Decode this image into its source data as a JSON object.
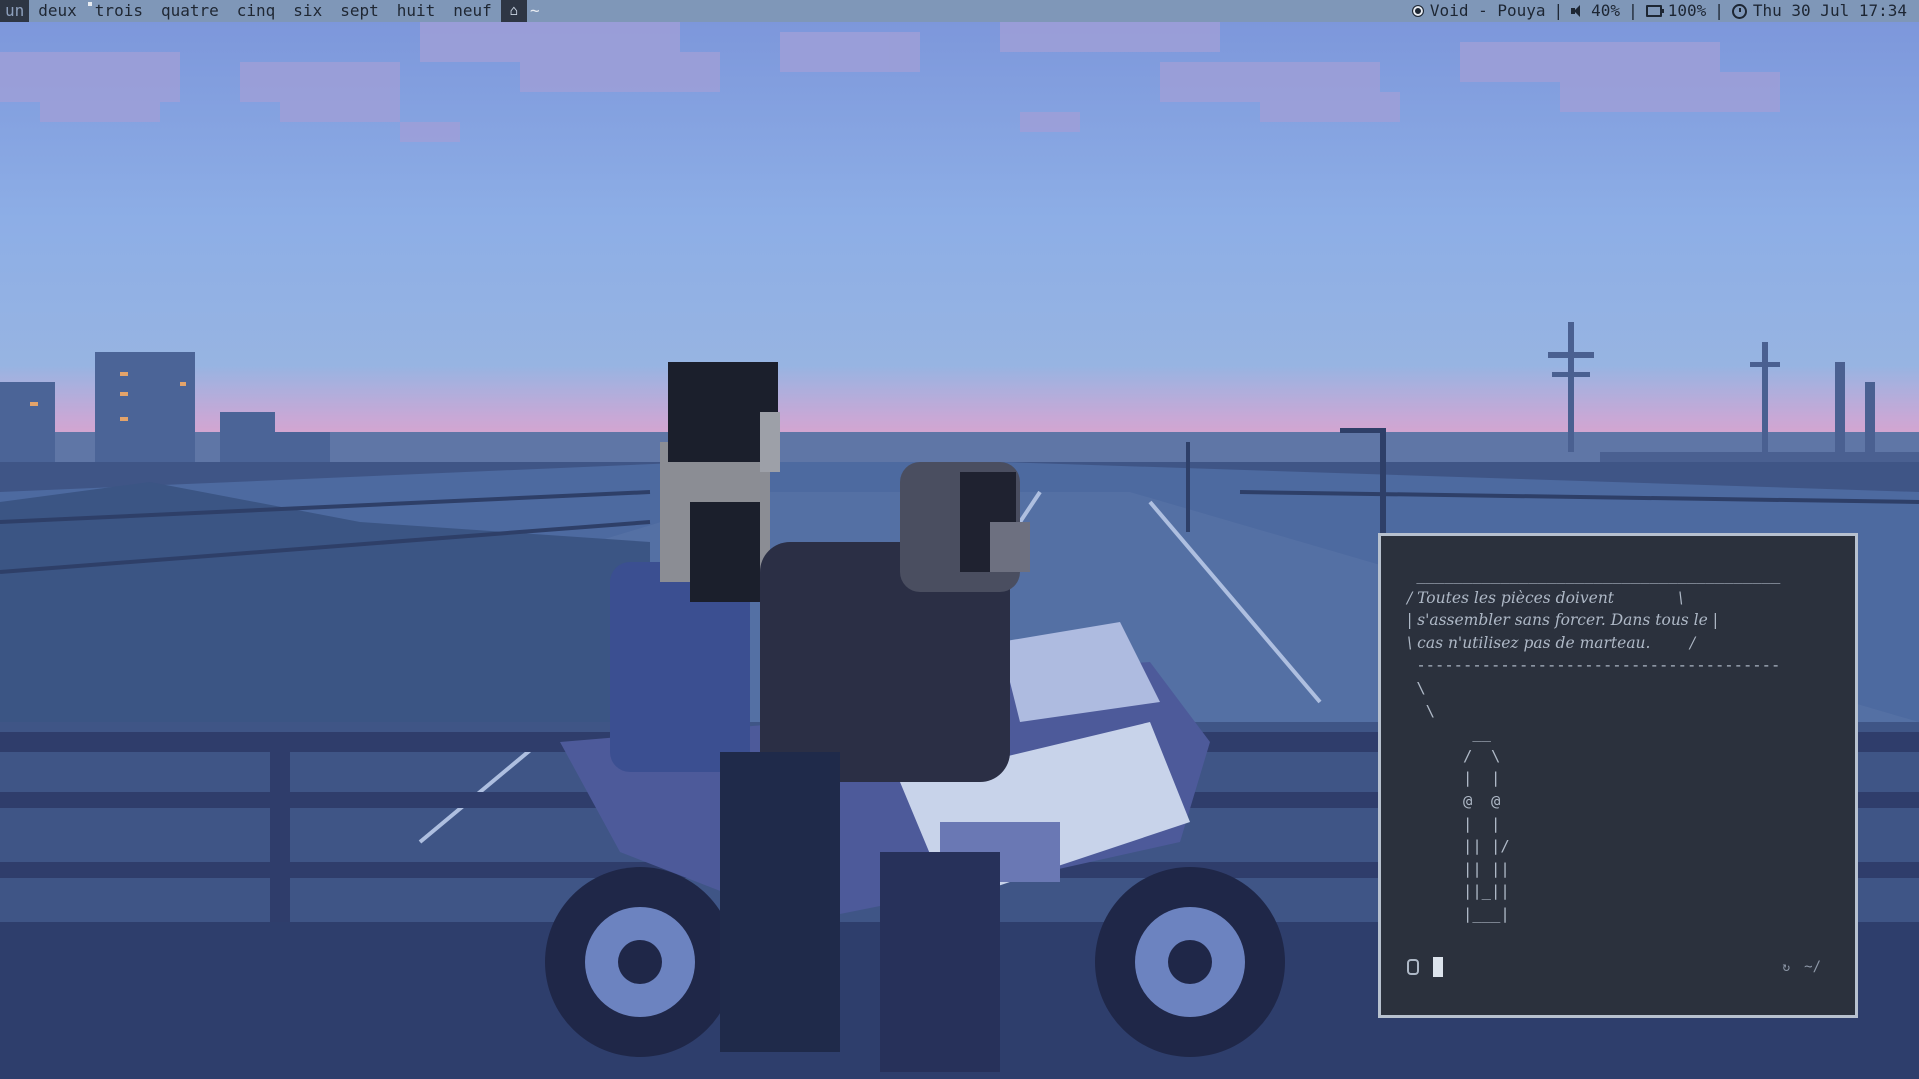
{
  "workspaces": [
    {
      "label": "un",
      "active": true,
      "occupied": false
    },
    {
      "label": "deux",
      "active": false,
      "occupied": false
    },
    {
      "label": "trois",
      "active": false,
      "occupied": true
    },
    {
      "label": "quatre",
      "active": false,
      "occupied": false
    },
    {
      "label": "cinq",
      "active": false,
      "occupied": false
    },
    {
      "label": "six",
      "active": false,
      "occupied": false
    },
    {
      "label": "sept",
      "active": false,
      "occupied": false
    },
    {
      "label": "huit",
      "active": false,
      "occupied": false
    },
    {
      "label": "neuf",
      "active": false,
      "occupied": false
    }
  ],
  "layout": {
    "icon": "app-icon",
    "symbol": "~"
  },
  "status": {
    "now_playing": "Void - Pouya",
    "volume": "40%",
    "battery": "100%",
    "datetime": "Thu 30 Jul 17:34",
    "separator": "|"
  },
  "terminal": {
    "cowsay_top": " _______________________________________",
    "cowsay_lines": [
      "/ Toutes les pièces doivent             \\",
      "| s'assembler sans forcer. Dans tous le |",
      "\\ cas n'utilisez pas de marteau.        /"
    ],
    "cowsay_bottom": " ---------------------------------------",
    "art": [
      " \\",
      "  \\",
      "       __",
      "      /  \\",
      "      |  |",
      "      @  @",
      "      |  |",
      "      || |/",
      "      || ||",
      "      ||_||",
      "      |___|"
    ],
    "right_prompt": "~/"
  },
  "colors": {
    "bar_bg": "#7f97b8",
    "active_ws_bg": "#2e3644",
    "terminal_bg": "#2b313d",
    "terminal_border": "#b7c1cf",
    "terminal_fg": "#aeb8c6"
  }
}
